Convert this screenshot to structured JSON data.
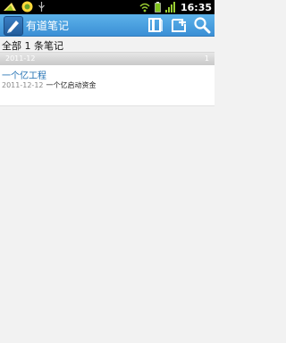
{
  "status_bar": {
    "time": "16:35",
    "left_icons": [
      "signal-weak-icon",
      "android-app-icon",
      "usb-icon"
    ],
    "right_icons": [
      "wifi-icon",
      "battery-charging-icon",
      "cell-signal-icon"
    ]
  },
  "titlebar": {
    "title": "有道笔记",
    "actions": [
      "notebook-icon",
      "add-note-icon",
      "search-icon"
    ]
  },
  "summary": "全部 1 条笔记",
  "groups": [
    {
      "date": "2011-12",
      "count": "1",
      "notes": [
        {
          "title": "一个亿工程",
          "date": "2011-12-12",
          "preview": "一个亿启动资金"
        }
      ]
    }
  ],
  "colors": {
    "accent": "#3b8fd5",
    "title_link": "#1f6fb2"
  }
}
